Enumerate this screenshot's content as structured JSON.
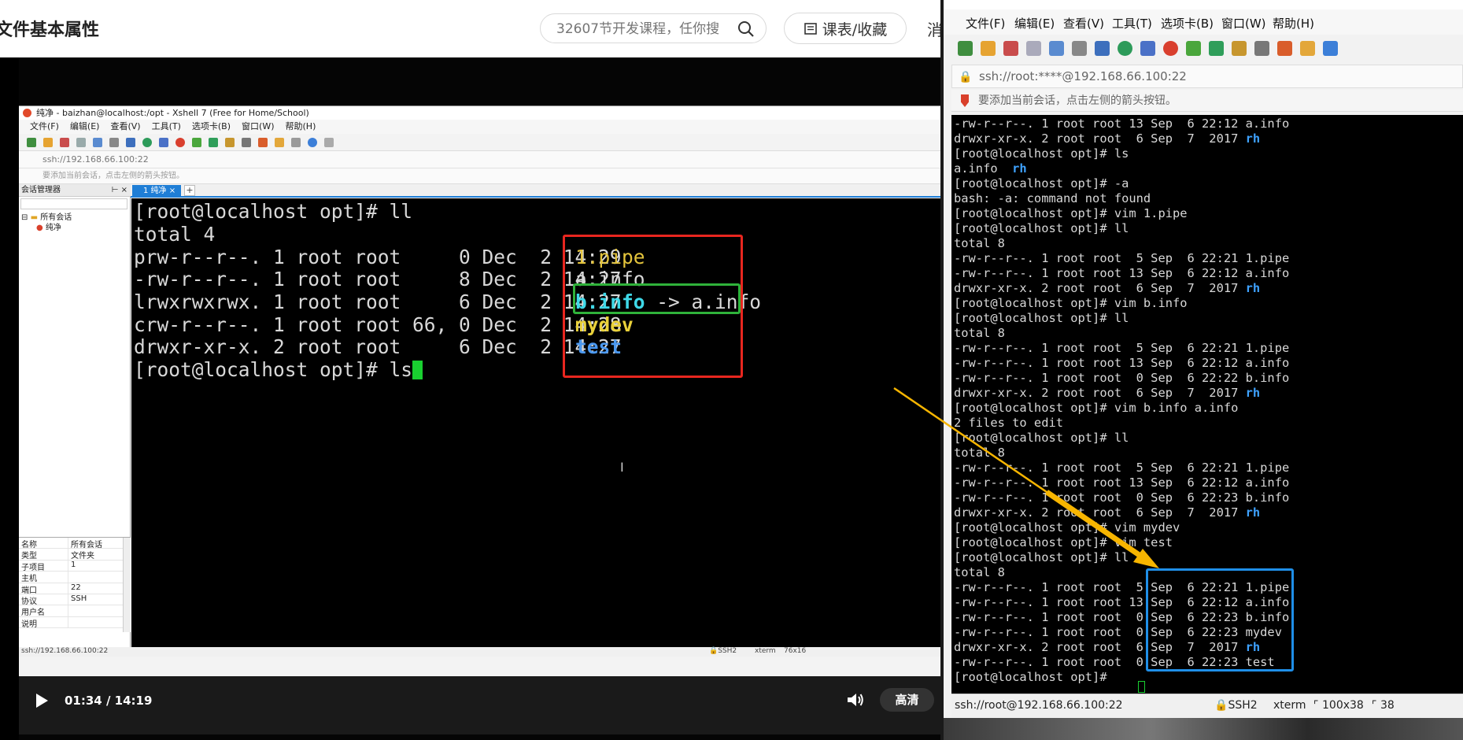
{
  "course_page": {
    "title": "文件基本属性",
    "search_placeholder": "32607节开发课程，任你搜",
    "schedule_button": "课表/收藏",
    "more_label": "消"
  },
  "video": {
    "time": "01:34 / 14:19",
    "quality": "高清"
  },
  "embedded_xshell": {
    "window_title": "纯净 - baizhan@localhost:/opt - Xshell 7 (Free for Home/School)",
    "menus": [
      "文件(F)",
      "编辑(E)",
      "查看(V)",
      "工具(T)",
      "选项卡(B)",
      "窗口(W)",
      "帮助(H)"
    ],
    "address": "ssh://192.168.66.100:22",
    "hint": "要添加当前会话，点击左侧的箭头按钮。",
    "session_manager": "会话管理器",
    "tree_root": "所有会话",
    "tree_child": "纯净",
    "tab_label": "1 纯净",
    "properties": [
      {
        "key": "名称",
        "value": "所有会话"
      },
      {
        "key": "类型",
        "value": "文件夹"
      },
      {
        "key": "子项目",
        "value": "1"
      },
      {
        "key": "主机",
        "value": ""
      },
      {
        "key": "端口",
        "value": "22"
      },
      {
        "key": "协议",
        "value": "SSH"
      },
      {
        "key": "用户名",
        "value": ""
      },
      {
        "key": "说明",
        "value": ""
      }
    ],
    "status_address": "ssh://192.168.66.100:22",
    "status_protocol": "SSH2",
    "status_term": "xterm",
    "status_size": "76x16",
    "terminal": {
      "prompt_ll": "[root@localhost opt]# ll",
      "total": "total 4",
      "rows": [
        {
          "meta": "prw-r--r--. 1 root root     0 Dec  2 14:29",
          "name": "1.pipe"
        },
        {
          "meta": "-rw-r--r--. 1 root root     8 Dec  2 14:27",
          "name": "a.info"
        },
        {
          "meta": "lrwxrwxrwx. 1 root root     6 Dec  2 14:27",
          "name": "b.info",
          "link": " -> a.info"
        },
        {
          "meta": "crw-r--r--. 1 root root 66, 0 Dec  2 14:28",
          "name": "mydev"
        },
        {
          "meta": "drwxr-xr-x. 2 root root     6 Dec  2 14:27",
          "name": "test"
        }
      ],
      "prompt_ls": "[root@localhost opt]# ls"
    }
  },
  "right_xshell": {
    "menus": [
      "文件(F)",
      "编辑(E)",
      "查看(V)",
      "工具(T)",
      "选项卡(B)",
      "窗口(W)",
      "帮助(H)"
    ],
    "address": "ssh://root:****@192.168.66.100:22",
    "hint": "要添加当前会话，点击左侧的箭头按钮。",
    "status_address": "ssh://root@192.168.66.100:22",
    "status_protocol": "SSH2",
    "status_term": "xterm",
    "status_size": "100x38",
    "status_extra": "38",
    "terminal_lines": [
      [
        "-rw-r--r--. 1 root root 13 Sep  6 22:12 a.info",
        ""
      ],
      [
        "drwxr-xr-x. 2 root root  6 Sep  7  2017 ",
        "rh"
      ],
      [
        "[root@localhost opt]# ls",
        ""
      ],
      [
        "a.info  ",
        "rh"
      ],
      [
        "[root@localhost opt]# -a",
        ""
      ],
      [
        "bash: -a: command not found",
        ""
      ],
      [
        "[root@localhost opt]# vim 1.pipe",
        ""
      ],
      [
        "[root@localhost opt]# ll",
        ""
      ],
      [
        "total 8",
        ""
      ],
      [
        "-rw-r--r--. 1 root root  5 Sep  6 22:21 1.pipe",
        ""
      ],
      [
        "-rw-r--r--. 1 root root 13 Sep  6 22:12 a.info",
        ""
      ],
      [
        "drwxr-xr-x. 2 root root  6 Sep  7  2017 ",
        "rh"
      ],
      [
        "[root@localhost opt]# vim b.info",
        ""
      ],
      [
        "[root@localhost opt]# ll",
        ""
      ],
      [
        "total 8",
        ""
      ],
      [
        "-rw-r--r--. 1 root root  5 Sep  6 22:21 1.pipe",
        ""
      ],
      [
        "-rw-r--r--. 1 root root 13 Sep  6 22:12 a.info",
        ""
      ],
      [
        "-rw-r--r--. 1 root root  0 Sep  6 22:22 b.info",
        ""
      ],
      [
        "drwxr-xr-x. 2 root root  6 Sep  7  2017 ",
        "rh"
      ],
      [
        "[root@localhost opt]# vim b.info a.info",
        ""
      ],
      [
        "2 files to edit",
        ""
      ],
      [
        "[root@localhost opt]# ll",
        ""
      ],
      [
        "total 8",
        ""
      ],
      [
        "-rw-r--r--. 1 root root  5 Sep  6 22:21 1.pipe",
        ""
      ],
      [
        "-rw-r--r--. 1 root root 13 Sep  6 22:12 a.info",
        ""
      ],
      [
        "-rw-r--r--. 1 root root  0 Sep  6 22:23 b.info",
        ""
      ],
      [
        "drwxr-xr-x. 2 root root  6 Sep  7  2017 ",
        "rh"
      ],
      [
        "[root@localhost opt]# vim mydev",
        ""
      ],
      [
        "[root@localhost opt]# vim test",
        ""
      ],
      [
        "[root@localhost opt]# ll",
        ""
      ],
      [
        "total 8",
        ""
      ],
      [
        "-rw-r--r--. 1 root root  5 Sep  6 22:21 1.pipe",
        ""
      ],
      [
        "-rw-r--r--. 1 root root 13 Sep  6 22:12 a.info",
        ""
      ],
      [
        "-rw-r--r--. 1 root root  0 Sep  6 22:23 b.info",
        ""
      ],
      [
        "-rw-r--r--. 1 root root  0 Sep  6 22:23 mydev",
        ""
      ],
      [
        "drwxr-xr-x. 2 root root  6 Sep  7  2017 ",
        "rh"
      ],
      [
        "-rw-r--r--. 1 root root  0 Sep  6 22:23 test",
        ""
      ],
      [
        "[root@localhost opt]# ",
        ""
      ]
    ]
  },
  "colors": {
    "red_box": "#e8261f",
    "green_box": "#2fb23a",
    "blue_box": "#1f8fe8",
    "arrow": "#f7b500",
    "cursor": "#19d030"
  }
}
